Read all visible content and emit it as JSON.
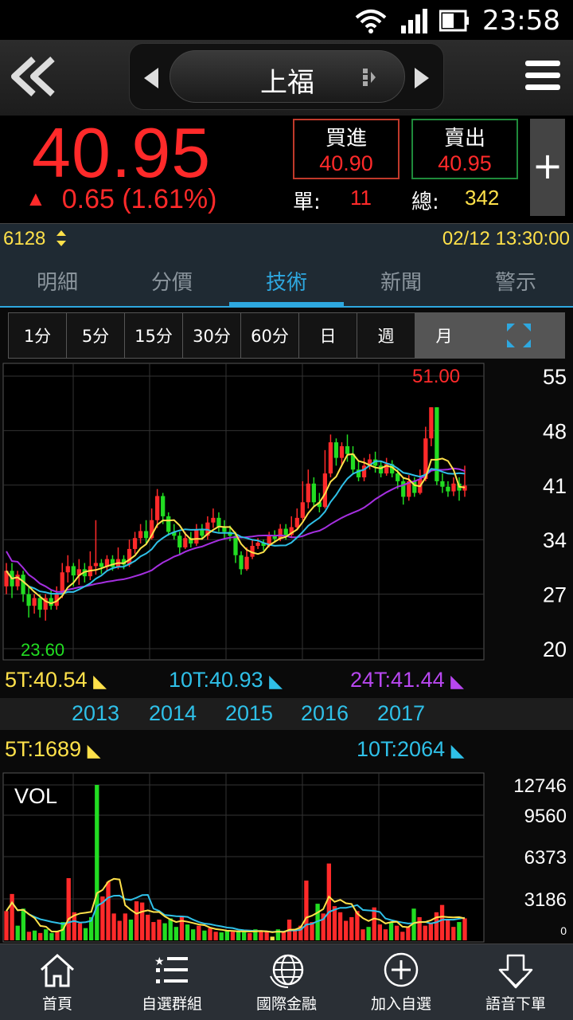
{
  "status_bar": {
    "time": "23:58"
  },
  "nav": {
    "stock_name": "上福"
  },
  "quote": {
    "price": "40.95",
    "change": "0.65 (1.61%)",
    "buy_label": "買進",
    "buy_price": "40.90",
    "sell_label": "賣出",
    "sell_price": "40.95",
    "unit_label": "單:",
    "unit_value": "11",
    "total_label": "總:",
    "total_value": "342"
  },
  "info": {
    "code": "6128",
    "datetime": "02/12 13:30:00"
  },
  "tabs": [
    "明細",
    "分價",
    "技術",
    "新聞",
    "警示"
  ],
  "active_tab": "技術",
  "periods": [
    "1分",
    "5分",
    "15分",
    "30分",
    "60分",
    "日",
    "週",
    "月"
  ],
  "active_period": "月",
  "ma": {
    "ma5": "5T:40.54",
    "ma10": "10T:40.93",
    "ma24": "24T:41.44"
  },
  "years": [
    "2013",
    "2014",
    "2015",
    "2016",
    "2017"
  ],
  "vol_ma": {
    "ma5": "5T:1689",
    "ma10": "10T:2064"
  },
  "bottom_nav": [
    "首頁",
    "自選群組",
    "國際金融",
    "加入自選",
    "語音下單"
  ],
  "colors": {
    "up": "#ff2a2a",
    "down": "#22dd22",
    "ma5": "#ffe14a",
    "ma10": "#2fc0e8",
    "ma24": "#a52fe0",
    "accent": "#2ea8e0"
  },
  "chart_data": [
    {
      "type": "candlestick",
      "title": "",
      "y_ticks": [
        55,
        48,
        41,
        34,
        27,
        20
      ],
      "ylim": [
        20,
        55
      ],
      "high_label": "51.00",
      "low_label": "23.60",
      "x_tick_labels": [
        "2013",
        "2014",
        "2015",
        "2016",
        "2017"
      ],
      "series": [
        {
          "name": "5T",
          "value": 40.54
        },
        {
          "name": "10T",
          "value": 40.93
        },
        {
          "name": "24T",
          "value": 41.44
        }
      ]
    },
    {
      "type": "bar",
      "title": "VOL",
      "y_ticks": [
        12746,
        9560,
        6373,
        3186,
        0
      ],
      "ylim": [
        0,
        12746
      ],
      "series": [
        {
          "name": "5T",
          "value": 1689
        },
        {
          "name": "10T",
          "value": 2064
        }
      ]
    }
  ]
}
